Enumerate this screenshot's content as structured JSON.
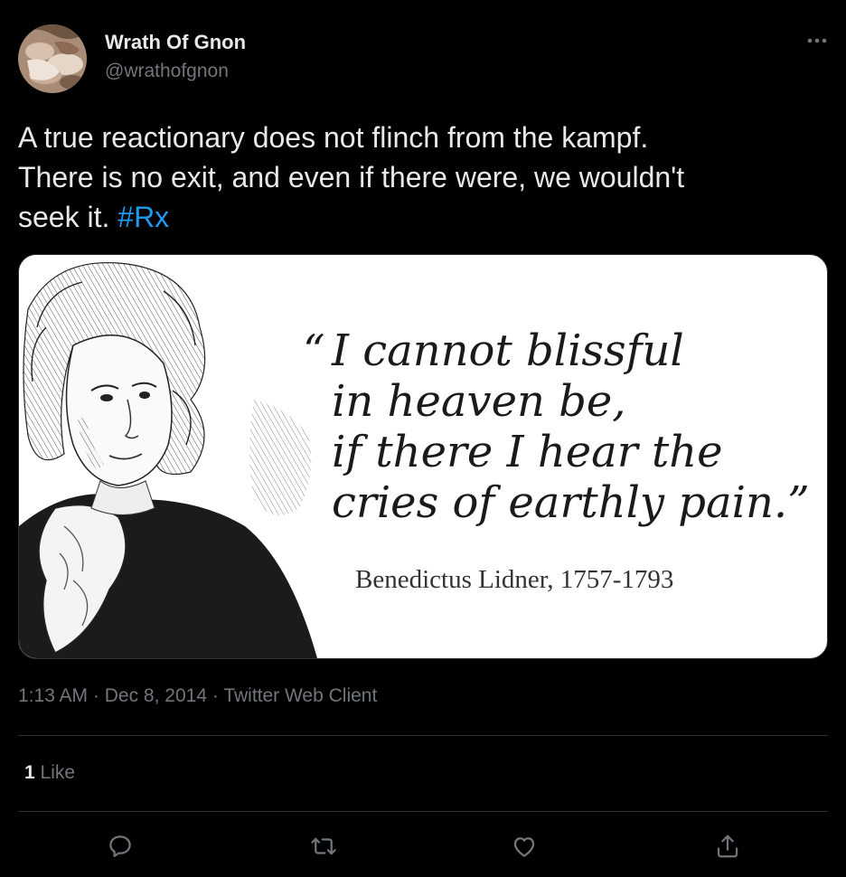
{
  "author": {
    "display_name": "Wrath Of Gnon",
    "handle": "@wrathofgnon",
    "avatar_icon": "avatar-image"
  },
  "tweet": {
    "text_line_1": "A true reactionary does not flinch from the kampf.",
    "text_line_2": "There is no exit, and even if there were, we wouldn't",
    "text_line_3_prefix": "seek it. ",
    "hashtag": "#Rx"
  },
  "media": {
    "quote_open": "“",
    "quote_lines": [
      "I cannot blissful",
      "in heaven be,",
      "if there I hear the",
      "cries of earthly pain."
    ],
    "quote_close": "”",
    "attribution": "Benedictus Lidner, 1757-1793"
  },
  "meta": {
    "time": "1:13 AM",
    "separator": "·",
    "date": "Dec 8, 2014",
    "client": "Twitter Web Client"
  },
  "stats": {
    "likes_count": "1",
    "likes_label": "Like"
  },
  "actions": {
    "reply_icon": "reply-icon",
    "retweet_icon": "retweet-icon",
    "like_icon": "heart-icon",
    "share_icon": "share-icon"
  },
  "colors": {
    "background": "#000000",
    "primary_text": "#e7e9ea",
    "secondary_text": "#71767b",
    "accent": "#1d9bf0",
    "divider": "#2f3336"
  }
}
